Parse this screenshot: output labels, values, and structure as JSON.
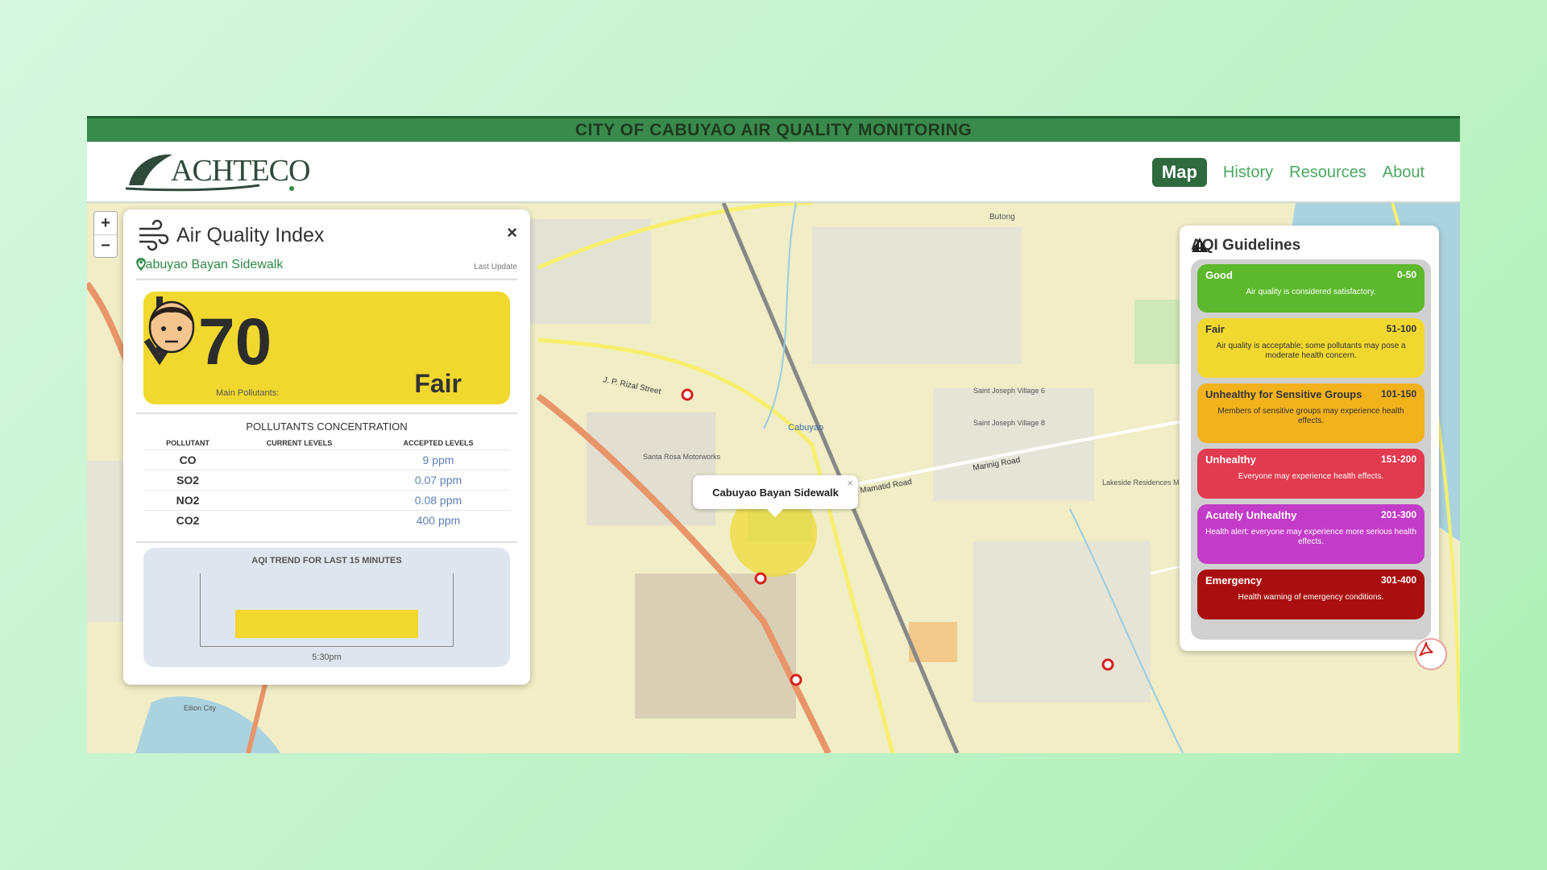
{
  "banner": {
    "title": "CITY OF CABUYAO AIR QUALITY MONITORING"
  },
  "brand": {
    "logo_text": "ACHTECO"
  },
  "nav": {
    "items": [
      "Map",
      "History",
      "Resources",
      "About"
    ],
    "active": "Map"
  },
  "map": {
    "zoom_in": "+",
    "zoom_out": "−",
    "popup_label": "Cabuyao Bayan Sidewalk",
    "popup_close": "×",
    "labels": [
      "J. P. Rizal Street",
      "Mamatid Road",
      "Marinig Road",
      "Cabuyao",
      "Saint Joseph Village 6",
      "Saint Joseph Village 8",
      "Butong",
      "Santa Rosa Motorworks",
      "Lakeside Residences Marinig",
      "Ellion City"
    ]
  },
  "aqi_panel": {
    "title": "Air Quality Index",
    "close": "×",
    "location": "Cabuyao Bayan Sidewalk",
    "last_update_label": "Last Update",
    "aqi_value": "70",
    "trend_direction": "down",
    "main_pollutants_label": "Main Pollutants:",
    "category": "Fair",
    "category_color": "#f0d82e",
    "pollutants_title": "POLLUTANTS CONCENTRATION",
    "columns": [
      "POLLUTANT",
      "CURRENT LEVELS",
      "ACCEPTED LEVELS"
    ],
    "rows": [
      {
        "pollutant": "CO",
        "current": "",
        "accepted": "9 ppm"
      },
      {
        "pollutant": "SO2",
        "current": "",
        "accepted": "0.07 ppm"
      },
      {
        "pollutant": "NO2",
        "current": "",
        "accepted": "0.08 ppm"
      },
      {
        "pollutant": "CO2",
        "current": "",
        "accepted": "400 ppm"
      }
    ],
    "trend_title": "AQI TREND FOR LAST 15 MINUTES",
    "trend_x_label": "5:30pm"
  },
  "chart_data": {
    "type": "bar",
    "title": "AQI TREND FOR LAST 15 MINUTES",
    "categories": [
      "5:30pm"
    ],
    "values": [
      70
    ],
    "ylim": [
      0,
      100
    ]
  },
  "guidelines": {
    "title": "AQI Guidelines",
    "items": [
      {
        "name": "Good",
        "range": "0-50",
        "desc": "Air quality is considered satisfactory.",
        "color": "#5cb82c"
      },
      {
        "name": "Fair",
        "range": "51-100",
        "desc": "Air quality is acceptable; some pollutants may pose a moderate health concern.",
        "color": "#f0d82e"
      },
      {
        "name": "Unhealthy for Sensitive Groups",
        "range": "101-150",
        "desc": "Members of sensitive groups may experience health effects.",
        "color": "#f2b21c"
      },
      {
        "name": "Unhealthy",
        "range": "151-200",
        "desc": "Everyone may experience health effects.",
        "color": "#e23a4e"
      },
      {
        "name": "Acutely Unhealthy",
        "range": "201-300",
        "desc": "Health alert: everyone may experience more serious health effects.",
        "color": "#c33cc8"
      },
      {
        "name": "Emergency",
        "range": "301-400",
        "desc": "Health warning of emergency conditions.",
        "color": "#a90f10"
      }
    ]
  }
}
